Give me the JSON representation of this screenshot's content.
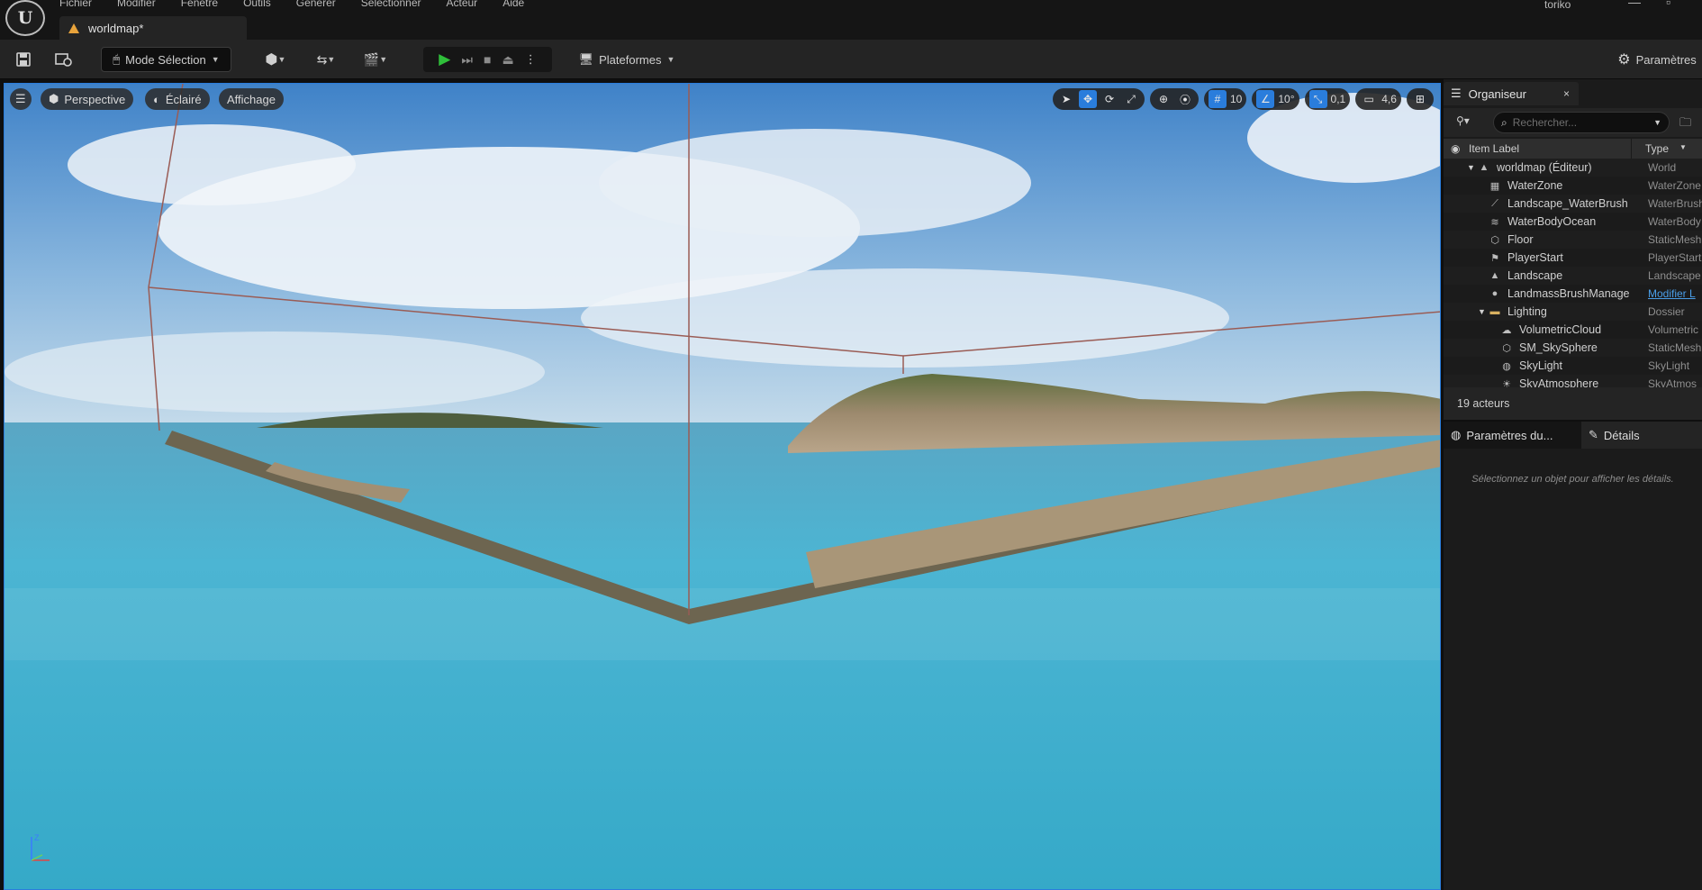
{
  "menu": [
    "Fichier",
    "Modifier",
    "Fenêtre",
    "Outils",
    "Générer",
    "Sélectionner",
    "Acteur",
    "Aide"
  ],
  "user": "toriko",
  "doc_tab": "worldmap*",
  "toolbar": {
    "mode_label": "Mode Sélection",
    "platforms_label": "Plateformes",
    "settings_label": "Paramètres"
  },
  "viewport": {
    "perspective_label": "Perspective",
    "lit_label": "Éclairé",
    "show_label": "Affichage",
    "grid_snap": "10",
    "rotation_snap": "10°",
    "scale_snap": "0,1",
    "camera_speed": "4,6"
  },
  "outliner": {
    "tab_label": "Organiseur",
    "close_glyph": "×",
    "search_placeholder": "Rechercher...",
    "col_label": "Item Label",
    "col_type": "Type",
    "items": [
      {
        "label": "worldmap (Éditeur)",
        "type": "World",
        "icon": "world-icon"
      },
      {
        "label": "WaterZone",
        "type": "WaterZone",
        "icon": "water-zone-icon"
      },
      {
        "label": "Landscape_WaterBrush",
        "type": "WaterBrush",
        "icon": "brush-icon"
      },
      {
        "label": "WaterBodyOcean",
        "type": "WaterBody",
        "icon": "waves-icon"
      },
      {
        "label": "Floor",
        "type": "StaticMesh",
        "icon": "cube-icon"
      },
      {
        "label": "PlayerStart",
        "type": "PlayerStart",
        "icon": "player-start-icon"
      },
      {
        "label": "Landscape",
        "type": "Landscape",
        "icon": "mountain-icon"
      },
      {
        "label": "LandmassBrushManage",
        "type": "Modifier L",
        "icon": "sphere-icon"
      },
      {
        "label": "Lighting",
        "type": "Dossier",
        "icon": "folder-icon"
      },
      {
        "label": "VolumetricCloud",
        "type": "Volumetric",
        "icon": "cloud-icon"
      },
      {
        "label": "SM_SkySphere",
        "type": "StaticMesh",
        "icon": "cube-icon"
      },
      {
        "label": "SkyLight",
        "type": "SkyLight",
        "icon": "skylight-icon"
      },
      {
        "label": "SkyAtmosphere",
        "type": "SkyAtmos",
        "icon": "sun-icon"
      }
    ],
    "actor_count": "19 acteurs"
  },
  "details": {
    "tab_world_settings": "Paramètres du...",
    "tab_details": "Détails",
    "hint": "Sélectionnez un objet pour afficher les détails."
  },
  "colors": {
    "accent_blue": "#2a7ddc",
    "play_green": "#2fbf3a",
    "tab_orange": "#e8a33b",
    "sky_top": "#4c8fd4",
    "water": "#3fb0d0"
  }
}
